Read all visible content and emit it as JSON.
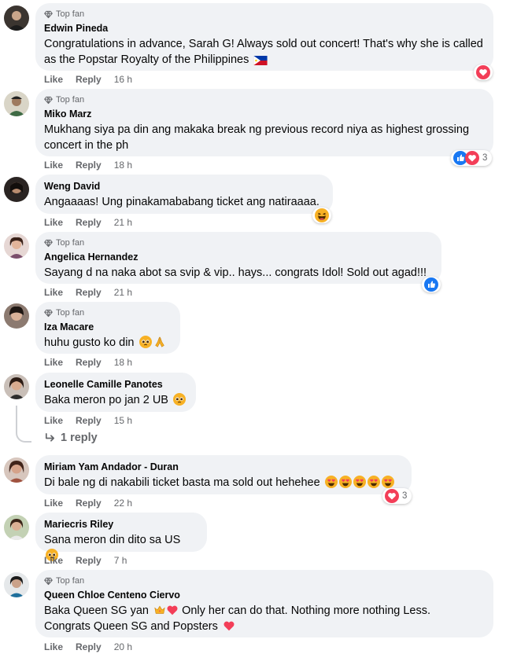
{
  "labels": {
    "top_fan": "Top fan",
    "like": "Like",
    "reply": "Reply"
  },
  "colors": {
    "bubble": "#f0f2f5",
    "secondary_text": "#65676b",
    "like_blue": "#1877f2",
    "love_red": "#f33e58",
    "haha_yellow": "#f7b125"
  },
  "comments": [
    {
      "author": "Edwin Pineda",
      "top_fan": true,
      "text": "Congratulations in advance, Sarah G! Always sold out concert! That's why she is called as the Popstar Royalty of the Philippines",
      "emoji": "philippines-flag",
      "time": "16 h",
      "reactions": [
        "love"
      ],
      "reaction_count": ""
    },
    {
      "author": "Miko Marz",
      "top_fan": true,
      "text": "Mukhang siya pa din ang makaka break ng previous record niya as highest grossing concert in the ph",
      "time": "18 h",
      "reactions": [
        "like",
        "love"
      ],
      "reaction_count": "3"
    },
    {
      "author": "Weng David",
      "top_fan": false,
      "text": "Angaaaas! Ung pinakamababang ticket ang natiraaaa.",
      "time": "21 h",
      "reactions": [
        "haha"
      ],
      "reaction_count": ""
    },
    {
      "author": "Angelica Hernandez",
      "top_fan": true,
      "text": "Sayang d na naka abot sa svip & vip.. hays... congrats Idol! Sold out agad!!!",
      "time": "21 h",
      "reactions": [
        "like"
      ],
      "reaction_count": ""
    },
    {
      "author": "Iza Macare",
      "top_fan": true,
      "text": "huhu gusto ko din",
      "time": "18 h",
      "reactions": [],
      "reaction_count": ""
    },
    {
      "author": "Leonelle Camille Panotes",
      "top_fan": false,
      "text": "Baka meron po jan 2 UB",
      "time": "15 h",
      "reactions": [],
      "reaction_count": "",
      "replies_label": "1 reply"
    },
    {
      "author": "Miriam Yam Andador - Duran",
      "top_fan": false,
      "text": "Di bale ng di nakabili ticket basta ma sold out hehehee",
      "time": "22 h",
      "reactions": [
        "love"
      ],
      "reaction_count": "3"
    },
    {
      "author": "Mariecris Riley",
      "top_fan": false,
      "text": "Sana meron din dito sa US",
      "time": "7 h",
      "reactions": [],
      "reaction_count": ""
    },
    {
      "author": "Queen Chloe Centeno Ciervo",
      "top_fan": true,
      "text_a": "Baka Queen SG yan",
      "text_b": "Only her can do that. Nothing more nothing Less.",
      "text_c": "Congrats Queen SG and Popsters",
      "time": "20 h",
      "reactions": [],
      "reaction_count": ""
    }
  ]
}
